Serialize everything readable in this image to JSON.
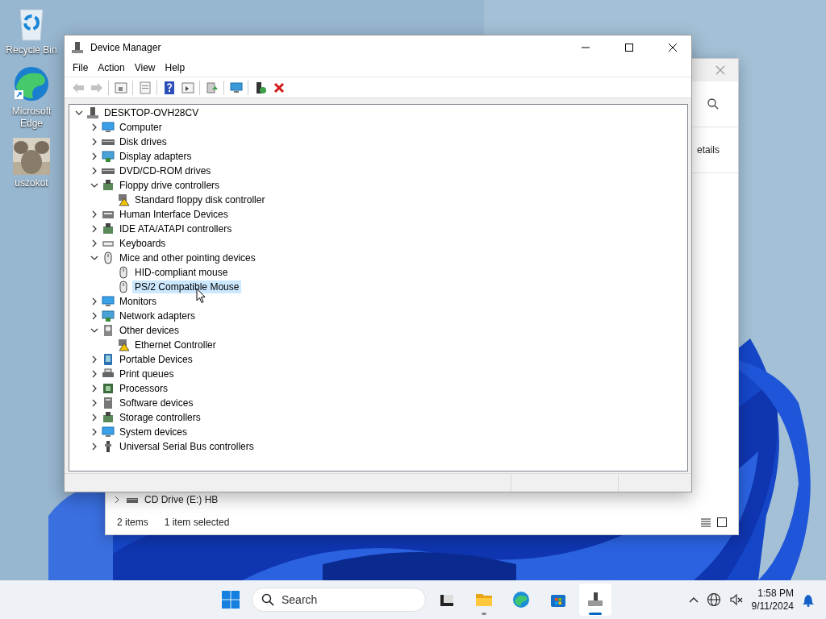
{
  "desktop_icons": [
    {
      "kind": "recycle",
      "label": "Recycle Bin"
    },
    {
      "kind": "edge",
      "label": "Microsoft Edge"
    },
    {
      "kind": "picture",
      "label": "uszokot"
    }
  ],
  "explorer": {
    "details_label": "etails",
    "rows": [
      {
        "label": "CD Drive (E:) HB",
        "expanded": false
      }
    ],
    "status": [
      "2 items",
      "1 item selected"
    ]
  },
  "window": {
    "title": "Device Manager",
    "menu": [
      "File",
      "Action",
      "View",
      "Help"
    ],
    "toolbar": [
      [
        {
          "kind": "back",
          "disabled": true
        },
        {
          "kind": "forward",
          "disabled": true
        }
      ],
      [
        {
          "kind": "tree",
          "disabled": false
        }
      ],
      [
        {
          "kind": "properties",
          "disabled": false
        }
      ],
      [
        {
          "kind": "help",
          "disabled": false
        },
        {
          "kind": "pane",
          "disabled": false
        }
      ],
      [
        {
          "kind": "update",
          "disabled": false
        }
      ],
      [
        {
          "kind": "scan",
          "disabled": false
        }
      ],
      [
        {
          "kind": "enable",
          "disabled": false
        },
        {
          "kind": "uninstall",
          "disabled": false
        }
      ]
    ],
    "tree": [
      {
        "label": "DESKTOP-OVH28CV",
        "kind": "pc",
        "expanded": true,
        "selected": false,
        "children": [
          {
            "label": "Computer",
            "kind": "monitor",
            "expanded": false,
            "selected": false
          },
          {
            "label": "Disk drives",
            "kind": "disk",
            "expanded": false,
            "selected": false
          },
          {
            "label": "Display adapters",
            "kind": "display",
            "expanded": false,
            "selected": false
          },
          {
            "label": "DVD/CD-ROM drives",
            "kind": "disk",
            "expanded": false,
            "selected": false
          },
          {
            "label": "Floppy drive controllers",
            "kind": "controller",
            "expanded": true,
            "selected": false,
            "children": [
              {
                "label": "Standard floppy disk controller",
                "kind": "warning",
                "selected": false
              }
            ]
          },
          {
            "label": "Human Interface Devices",
            "kind": "hid",
            "expanded": false,
            "selected": false
          },
          {
            "label": "IDE ATA/ATAPI controllers",
            "kind": "controller",
            "expanded": false,
            "selected": false
          },
          {
            "label": "Keyboards",
            "kind": "keyboard",
            "expanded": false,
            "selected": false
          },
          {
            "label": "Mice and other pointing devices",
            "kind": "mouse",
            "expanded": true,
            "selected": false,
            "children": [
              {
                "label": "HID-compliant mouse",
                "kind": "mouse",
                "selected": false
              },
              {
                "label": "PS/2 Compatible Mouse",
                "kind": "mouse",
                "selected": true
              }
            ]
          },
          {
            "label": "Monitors",
            "kind": "monitor",
            "expanded": false,
            "selected": false
          },
          {
            "label": "Network adapters",
            "kind": "display",
            "expanded": false,
            "selected": false
          },
          {
            "label": "Other devices",
            "kind": "other",
            "expanded": true,
            "selected": false,
            "children": [
              {
                "label": "Ethernet Controller",
                "kind": "warning",
                "selected": false
              }
            ]
          },
          {
            "label": "Portable Devices",
            "kind": "portable",
            "expanded": false,
            "selected": false
          },
          {
            "label": "Print queues",
            "kind": "printer",
            "expanded": false,
            "selected": false
          },
          {
            "label": "Processors",
            "kind": "processor",
            "expanded": false,
            "selected": false
          },
          {
            "label": "Software devices",
            "kind": "software",
            "expanded": false,
            "selected": false
          },
          {
            "label": "Storage controllers",
            "kind": "controller",
            "expanded": false,
            "selected": false
          },
          {
            "label": "System devices",
            "kind": "monitor",
            "expanded": false,
            "selected": false
          },
          {
            "label": "Universal Serial Bus controllers",
            "kind": "usb",
            "expanded": false,
            "selected": false
          }
        ]
      }
    ]
  },
  "taskbar": {
    "search_placeholder": "Search",
    "apps": [
      {
        "kind": "taskview",
        "running": false,
        "selected": false
      },
      {
        "kind": "folder",
        "running": true,
        "selected": false
      },
      {
        "kind": "edge",
        "running": false,
        "selected": false
      },
      {
        "kind": "store",
        "running": false,
        "selected": false
      },
      {
        "kind": "devmgr",
        "running": true,
        "selected": true
      }
    ],
    "time": "1:58 PM",
    "date": "9/11/2024"
  }
}
